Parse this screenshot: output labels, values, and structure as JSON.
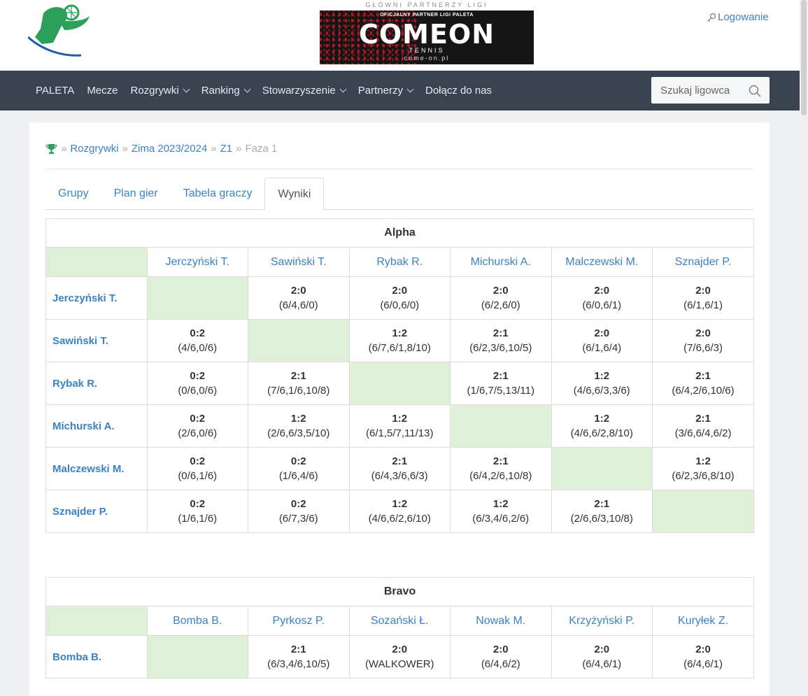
{
  "brand": {
    "logo_text": "PALETA"
  },
  "sponsor": {
    "caption": "GŁÓWNI PARTNERZY LIGI",
    "subline": "OFICJALNY PARTNER LIGI PALETA",
    "name": "COMEON",
    "tagline": "TENNIS",
    "url": "come-on.pl"
  },
  "login": {
    "label": "Logowanie",
    "icon": "key-icon"
  },
  "nav": {
    "items": [
      {
        "label": "PALETA",
        "dropdown": false
      },
      {
        "label": "Mecze",
        "dropdown": false
      },
      {
        "label": "Rozgrywki",
        "dropdown": true
      },
      {
        "label": "Ranking",
        "dropdown": true
      },
      {
        "label": "Stowarzyszenie",
        "dropdown": true
      },
      {
        "label": "Partnerzy",
        "dropdown": true
      },
      {
        "label": "Dołącz do nas",
        "dropdown": false
      }
    ],
    "search_placeholder": "Szukaj ligowca"
  },
  "breadcrumb": [
    "Rozgrywki",
    "Zima 2023/2024",
    "Z1",
    "Faza 1"
  ],
  "tabs": [
    {
      "label": "Grupy",
      "active": false
    },
    {
      "label": "Plan gier",
      "active": false
    },
    {
      "label": "Tabela graczy",
      "active": false
    },
    {
      "label": "Wyniki",
      "active": true
    }
  ],
  "groups": [
    {
      "name": "Alpha",
      "players": [
        "Jerczyński T.",
        "Sawiński T.",
        "Rybak R.",
        "Michurski A.",
        "Malczewski M.",
        "Sznajder P."
      ],
      "results": [
        [
          null,
          {
            "s": "2:0",
            "d": "(6/4,6/0)"
          },
          {
            "s": "2:0",
            "d": "(6/0,6/0)"
          },
          {
            "s": "2:0",
            "d": "(6/2,6/0)"
          },
          {
            "s": "2:0",
            "d": "(6/0,6/1)"
          },
          {
            "s": "2:0",
            "d": "(6/1,6/1)"
          }
        ],
        [
          {
            "s": "0:2",
            "d": "(4/6,0/6)"
          },
          null,
          {
            "s": "1:2",
            "d": "(6/7,6/1,8/10)"
          },
          {
            "s": "2:1",
            "d": "(6/2,3/6,10/5)"
          },
          {
            "s": "2:0",
            "d": "(6/1,6/4)"
          },
          {
            "s": "2:0",
            "d": "(7/6,6/3)"
          }
        ],
        [
          {
            "s": "0:2",
            "d": "(0/6,0/6)"
          },
          {
            "s": "2:1",
            "d": "(7/6,1/6,10/8)"
          },
          null,
          {
            "s": "2:1",
            "d": "(1/6,7/5,13/11)"
          },
          {
            "s": "1:2",
            "d": "(4/6,6/3,3/6)"
          },
          {
            "s": "2:1",
            "d": "(6/4,2/6,10/6)"
          }
        ],
        [
          {
            "s": "0:2",
            "d": "(2/6,0/6)"
          },
          {
            "s": "1:2",
            "d": "(2/6,6/3,5/10)"
          },
          {
            "s": "1:2",
            "d": "(6/1,5/7,11/13)"
          },
          null,
          {
            "s": "1:2",
            "d": "(4/6,6/2,8/10)"
          },
          {
            "s": "2:1",
            "d": "(3/6,6/4,6/2)"
          }
        ],
        [
          {
            "s": "0:2",
            "d": "(0/6,1/6)"
          },
          {
            "s": "0:2",
            "d": "(1/6,4/6)"
          },
          {
            "s": "2:1",
            "d": "(6/4,3/6,6/3)"
          },
          {
            "s": "2:1",
            "d": "(6/4,2/6,10/8)"
          },
          null,
          {
            "s": "1:2",
            "d": "(6/2,3/6,8/10)"
          }
        ],
        [
          {
            "s": "0:2",
            "d": "(1/6,1/6)"
          },
          {
            "s": "0:2",
            "d": "(6/7,3/6)"
          },
          {
            "s": "1:2",
            "d": "(4/6,6/2,6/10)"
          },
          {
            "s": "1:2",
            "d": "(6/3,4/6,2/6)"
          },
          {
            "s": "2:1",
            "d": "(2/6,6/3,10/8)"
          },
          null
        ]
      ]
    },
    {
      "name": "Bravo",
      "players": [
        "Bomba B.",
        "Pyrkosz P.",
        "Sozański Ł.",
        "Nowak M.",
        "Krzyżyński P.",
        "Kuryłek Z."
      ],
      "results": [
        [
          null,
          {
            "s": "2:1",
            "d": "(6/3,4/6,10/5)"
          },
          {
            "s": "2:0",
            "d": "(WALKOWER)"
          },
          {
            "s": "2:0",
            "d": "(6/4,6/2)"
          },
          {
            "s": "2:0",
            "d": "(6/4,6/1)"
          },
          {
            "s": "2:0",
            "d": "(6/4,6/1)"
          }
        ]
      ]
    }
  ],
  "colors": {
    "link": "#3b82c4",
    "self_cell": "#dff0d8",
    "nav_bg": "#3a4350"
  }
}
